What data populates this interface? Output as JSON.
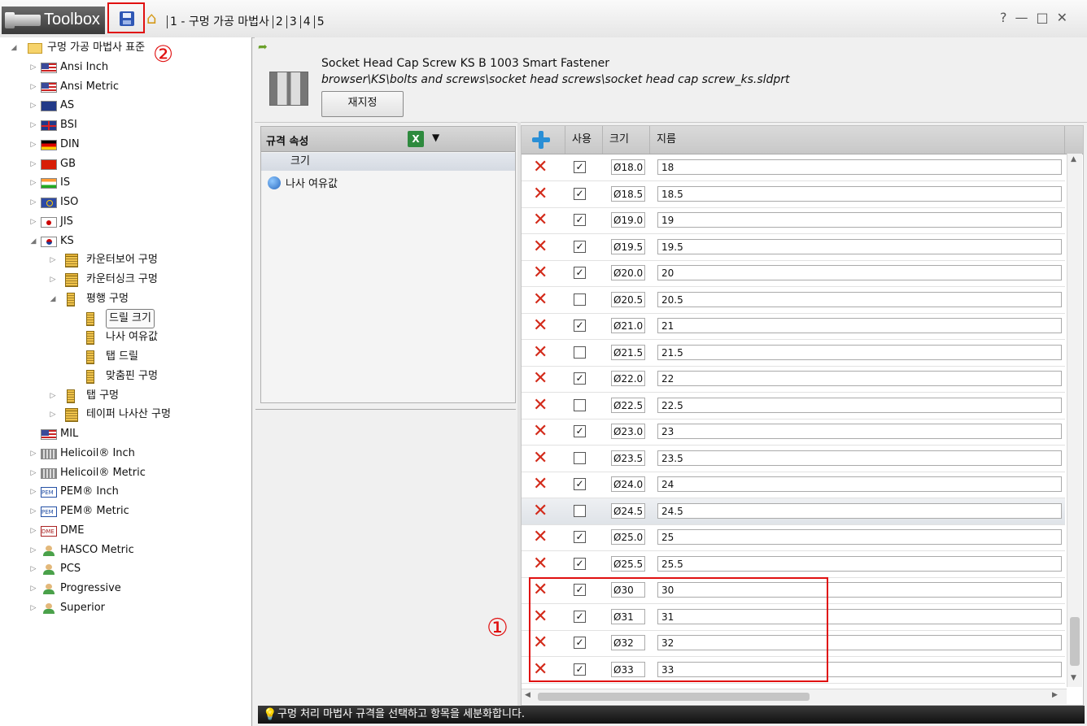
{
  "toolbar": {
    "brand": "Toolbox",
    "save_icon": "save-disk-icon",
    "home_icon": "home-icon",
    "steps": [
      "1 - 구멍 가공 마법사",
      "2",
      "3",
      "4",
      "5"
    ],
    "window_controls": [
      "?",
      "—",
      "□",
      "✕"
    ]
  },
  "callouts": {
    "one": "①",
    "two": "②"
  },
  "tree": {
    "items": [
      {
        "label": "구멍 가공 마법사 표준",
        "level": 0,
        "state": "expanded",
        "icon": "folder"
      },
      {
        "label": "Ansi Inch",
        "level": 1,
        "state": "collapsed",
        "icon": "us"
      },
      {
        "label": "Ansi Metric",
        "level": 1,
        "state": "collapsed",
        "icon": "us"
      },
      {
        "label": "AS",
        "level": 1,
        "state": "collapsed",
        "icon": "au"
      },
      {
        "label": "BSI",
        "level": 1,
        "state": "collapsed",
        "icon": "bsi"
      },
      {
        "label": "DIN",
        "level": 1,
        "state": "collapsed",
        "icon": "din"
      },
      {
        "label": "GB",
        "level": 1,
        "state": "collapsed",
        "icon": "gb"
      },
      {
        "label": "IS",
        "level": 1,
        "state": "collapsed",
        "icon": "is"
      },
      {
        "label": "ISO",
        "level": 1,
        "state": "collapsed",
        "icon": "iso"
      },
      {
        "label": "JIS",
        "level": 1,
        "state": "collapsed",
        "icon": "jis"
      },
      {
        "label": "KS",
        "level": 1,
        "state": "expanded",
        "icon": "ks"
      },
      {
        "label": "카운터보어 구멍",
        "level": 2,
        "state": "collapsed",
        "icon": "hole-cb"
      },
      {
        "label": "카운터싱크 구멍",
        "level": 2,
        "state": "collapsed",
        "icon": "hole-cb"
      },
      {
        "label": "평행 구멍",
        "level": 2,
        "state": "expanded",
        "icon": "hole"
      },
      {
        "label": "드릴 크기",
        "level": 3,
        "state": "leaf",
        "icon": "hole",
        "selected": true
      },
      {
        "label": "나사 여유값",
        "level": 3,
        "state": "leaf",
        "icon": "hole"
      },
      {
        "label": "탭 드릴",
        "level": 3,
        "state": "leaf",
        "icon": "hole"
      },
      {
        "label": "맞춤핀 구멍",
        "level": 3,
        "state": "leaf",
        "icon": "hole"
      },
      {
        "label": "탭 구멍",
        "level": 2,
        "state": "collapsed",
        "icon": "hole"
      },
      {
        "label": "테이퍼 나사산 구멍",
        "level": 2,
        "state": "collapsed",
        "icon": "hole-cb"
      },
      {
        "label": "MIL",
        "level": 1,
        "state": "leaf",
        "icon": "us"
      },
      {
        "label": "Helicoil® Inch",
        "level": 1,
        "state": "collapsed",
        "icon": "heli"
      },
      {
        "label": "Helicoil® Metric",
        "level": 1,
        "state": "collapsed",
        "icon": "heli"
      },
      {
        "label": "PEM® Inch",
        "level": 1,
        "state": "collapsed",
        "icon": "pem"
      },
      {
        "label": "PEM® Metric",
        "level": 1,
        "state": "collapsed",
        "icon": "pem"
      },
      {
        "label": "DME",
        "level": 1,
        "state": "collapsed",
        "icon": "dme"
      },
      {
        "label": "HASCO Metric",
        "level": 1,
        "state": "collapsed",
        "icon": "person"
      },
      {
        "label": "PCS",
        "level": 1,
        "state": "collapsed",
        "icon": "person"
      },
      {
        "label": "Progressive",
        "level": 1,
        "state": "collapsed",
        "icon": "person"
      },
      {
        "label": "Superior",
        "level": 1,
        "state": "collapsed",
        "icon": "person"
      }
    ]
  },
  "header": {
    "title": "Socket Head Cap Screw KS B 1003 Smart Fastener",
    "path": "browser\\KS\\bolts and screws\\socket head screws\\socket head cap screw_ks.sldprt",
    "reset_label": "재지정"
  },
  "properties": {
    "title": "규격 속성",
    "excel_icon": "excel-export-icon",
    "size_label": "크기",
    "thread_label": "나사 여유값"
  },
  "grid": {
    "columns": {
      "use": "사용",
      "size": "크기",
      "diameter": "지름"
    },
    "rows": [
      {
        "use": true,
        "size": "Ø18.0",
        "dia": "18"
      },
      {
        "use": true,
        "size": "Ø18.5",
        "dia": "18.5"
      },
      {
        "use": true,
        "size": "Ø19.0",
        "dia": "19"
      },
      {
        "use": true,
        "size": "Ø19.5",
        "dia": "19.5"
      },
      {
        "use": true,
        "size": "Ø20.0",
        "dia": "20"
      },
      {
        "use": false,
        "size": "Ø20.5",
        "dia": "20.5"
      },
      {
        "use": true,
        "size": "Ø21.0",
        "dia": "21"
      },
      {
        "use": false,
        "size": "Ø21.5",
        "dia": "21.5"
      },
      {
        "use": true,
        "size": "Ø22.0",
        "dia": "22"
      },
      {
        "use": false,
        "size": "Ø22.5",
        "dia": "22.5"
      },
      {
        "use": true,
        "size": "Ø23.0",
        "dia": "23"
      },
      {
        "use": false,
        "size": "Ø23.5",
        "dia": "23.5"
      },
      {
        "use": true,
        "size": "Ø24.0",
        "dia": "24"
      },
      {
        "use": false,
        "size": "Ø24.5",
        "dia": "24.5",
        "alt": true
      },
      {
        "use": true,
        "size": "Ø25.0",
        "dia": "25"
      },
      {
        "use": true,
        "size": "Ø25.5",
        "dia": "25.5"
      },
      {
        "use": true,
        "size": "Ø30",
        "dia": "30"
      },
      {
        "use": true,
        "size": "Ø31",
        "dia": "31"
      },
      {
        "use": true,
        "size": "Ø32",
        "dia": "32"
      },
      {
        "use": true,
        "size": "Ø33",
        "dia": "33"
      }
    ]
  },
  "status": {
    "text": "구멍 처리 마법사 규격을 선택하고 항목을 세분화합니다."
  }
}
